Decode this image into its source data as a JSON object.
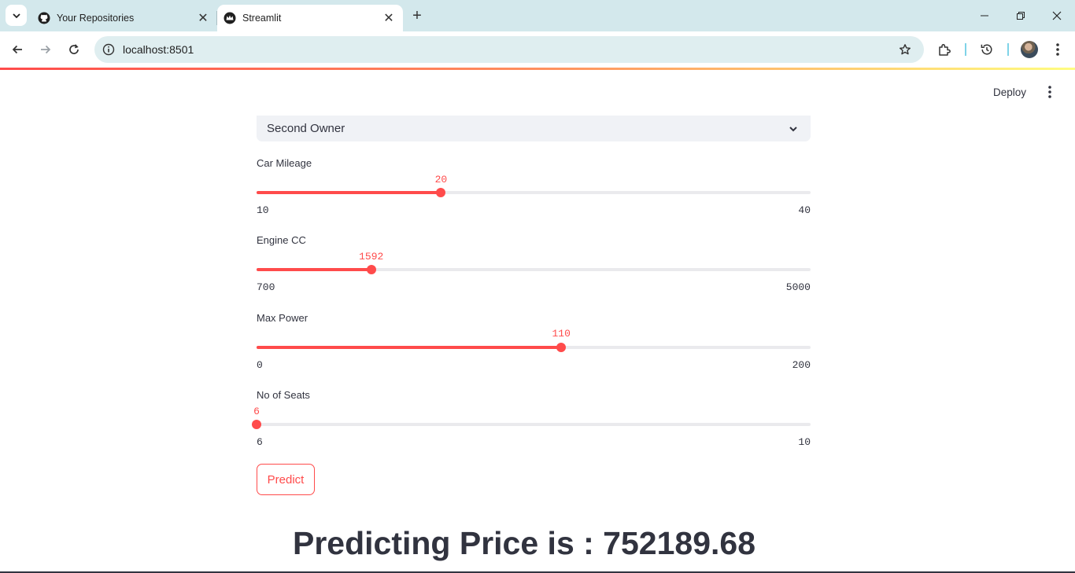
{
  "browser": {
    "tabs": [
      {
        "title": "Your Repositories",
        "icon": "github-icon",
        "active": false
      },
      {
        "title": "Streamlit",
        "icon": "streamlit-crown-icon",
        "active": true
      }
    ],
    "url": "localhost:8501"
  },
  "header": {
    "deploy_label": "Deploy"
  },
  "form": {
    "owner_select": {
      "value": "Second Owner"
    },
    "sliders": [
      {
        "label": "Car Mileage",
        "min": "10",
        "max": "40",
        "value": "20",
        "fraction": 0.333
      },
      {
        "label": "Engine CC",
        "min": "700",
        "max": "5000",
        "value": "1592",
        "fraction": 0.207
      },
      {
        "label": "Max Power",
        "min": "0",
        "max": "200",
        "value": "110",
        "fraction": 0.55
      },
      {
        "label": "No of Seats",
        "min": "6",
        "max": "10",
        "value": "6",
        "fraction": 0.0
      }
    ],
    "predict_label": "Predict"
  },
  "result": {
    "text": "Predicting Price is : 752189.68"
  },
  "colors": {
    "accent": "#ff4b4b",
    "text": "#31333f",
    "track": "#eaeaed",
    "select_bg": "#f0f2f6"
  }
}
